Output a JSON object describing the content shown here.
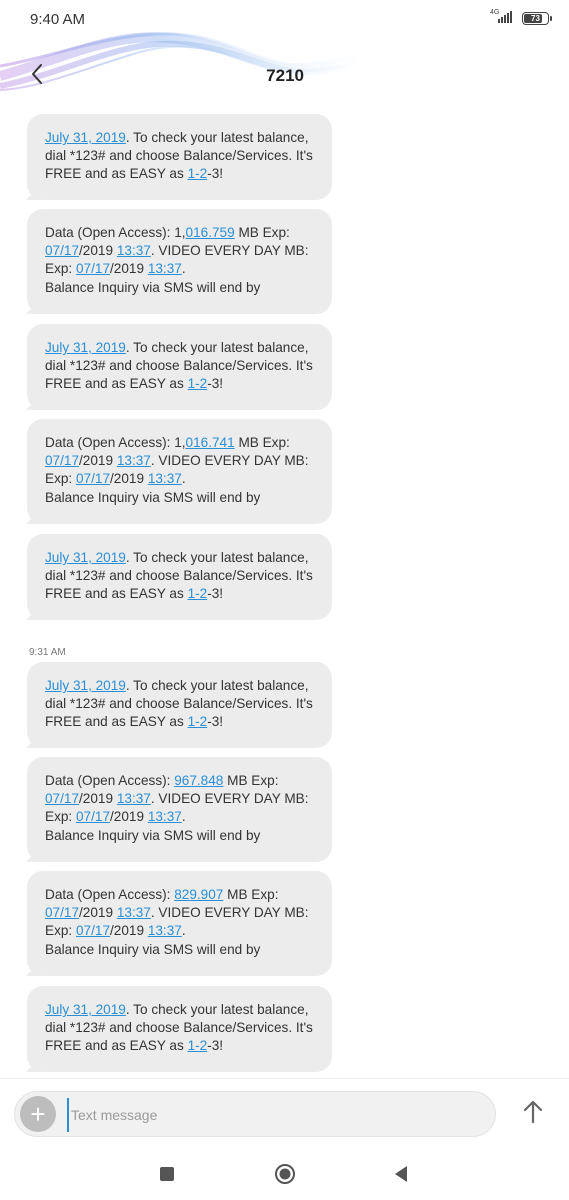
{
  "status_bar": {
    "time": "9:40 AM",
    "network_label": "4G",
    "battery_level": "73",
    "icons": [
      "signal-icon",
      "battery-icon"
    ]
  },
  "header": {
    "title": "7210",
    "back_icon": "chevron-left-icon"
  },
  "messages": [
    {
      "lines": [
        [
          {
            "t": " "
          },
          {
            "t": "July 31, 2019",
            "link": true
          },
          {
            "t": ".  To check your latest balance,"
          }
        ],
        [
          {
            "t": "dial *123# and choose Balance/Services. It's"
          }
        ],
        [
          {
            "t": "FREE and as EASY as "
          },
          {
            "t": "1-2",
            "link": true
          },
          {
            "t": "-3!"
          }
        ]
      ]
    },
    {
      "lines": [
        [
          {
            "t": "Data (Open Access): 1,"
          },
          {
            "t": "016.759",
            "link": true
          },
          {
            "t": " MB Exp:"
          }
        ],
        [
          {
            "t": "07/17",
            "link": true
          },
          {
            "t": "/2019 "
          },
          {
            "t": "13:37",
            "link": true
          },
          {
            "t": ".  VIDEO EVERY DAY MB:"
          }
        ],
        [
          {
            "t": "Exp: "
          },
          {
            "t": "07/17",
            "link": true
          },
          {
            "t": "/2019 "
          },
          {
            "t": "13:37",
            "link": true
          },
          {
            "t": "."
          }
        ],
        [
          {
            "t": " Balance Inquiry via SMS will end by"
          }
        ]
      ]
    },
    {
      "lines": [
        [
          {
            "t": " "
          },
          {
            "t": "July 31, 2019",
            "link": true
          },
          {
            "t": ".  To check your latest balance,"
          }
        ],
        [
          {
            "t": "dial *123# and choose Balance/Services. It's"
          }
        ],
        [
          {
            "t": "FREE and as EASY as "
          },
          {
            "t": "1-2",
            "link": true
          },
          {
            "t": "-3!"
          }
        ]
      ]
    },
    {
      "lines": [
        [
          {
            "t": "Data (Open Access): 1,"
          },
          {
            "t": "016.741",
            "link": true
          },
          {
            "t": " MB Exp:"
          }
        ],
        [
          {
            "t": "07/17",
            "link": true
          },
          {
            "t": "/2019 "
          },
          {
            "t": "13:37",
            "link": true
          },
          {
            "t": ".  VIDEO EVERY DAY MB:"
          }
        ],
        [
          {
            "t": "Exp: "
          },
          {
            "t": "07/17",
            "link": true
          },
          {
            "t": "/2019 "
          },
          {
            "t": "13:37",
            "link": true
          },
          {
            "t": "."
          }
        ],
        [
          {
            "t": " Balance Inquiry via SMS will end by"
          }
        ]
      ]
    },
    {
      "lines": [
        [
          {
            "t": " "
          },
          {
            "t": "July 31, 2019",
            "link": true
          },
          {
            "t": ".  To check your latest balance,"
          }
        ],
        [
          {
            "t": "dial *123# and choose Balance/Services. It's"
          }
        ],
        [
          {
            "t": "FREE and as EASY as "
          },
          {
            "t": "1-2",
            "link": true
          },
          {
            "t": "-3!"
          }
        ]
      ]
    },
    {
      "lines": [
        [
          {
            "t": " "
          },
          {
            "t": "July 31, 2019",
            "link": true
          },
          {
            "t": ".  To check your latest balance,"
          }
        ],
        [
          {
            "t": "dial *123# and choose Balance/Services. It's"
          }
        ],
        [
          {
            "t": "FREE and as EASY as "
          },
          {
            "t": "1-2",
            "link": true
          },
          {
            "t": "-3!"
          }
        ]
      ]
    },
    {
      "lines": [
        [
          {
            "t": "Data (Open Access): "
          },
          {
            "t": "967.848",
            "link": true
          },
          {
            "t": " MB Exp:"
          }
        ],
        [
          {
            "t": "07/17",
            "link": true
          },
          {
            "t": "/2019 "
          },
          {
            "t": "13:37",
            "link": true
          },
          {
            "t": ".  VIDEO EVERY DAY MB:"
          }
        ],
        [
          {
            "t": "Exp: "
          },
          {
            "t": "07/17",
            "link": true
          },
          {
            "t": "/2019 "
          },
          {
            "t": "13:37",
            "link": true
          },
          {
            "t": "."
          }
        ],
        [
          {
            "t": " Balance Inquiry via SMS will end by"
          }
        ]
      ]
    },
    {
      "lines": [
        [
          {
            "t": "Data (Open Access): "
          },
          {
            "t": "829.907",
            "link": true
          },
          {
            "t": " MB Exp:"
          }
        ],
        [
          {
            "t": "07/17",
            "link": true
          },
          {
            "t": "/2019 "
          },
          {
            "t": "13:37",
            "link": true
          },
          {
            "t": ".  VIDEO EVERY DAY MB:"
          }
        ],
        [
          {
            "t": "Exp: "
          },
          {
            "t": "07/17",
            "link": true
          },
          {
            "t": "/2019 "
          },
          {
            "t": "13:37",
            "link": true
          },
          {
            "t": "."
          }
        ],
        [
          {
            "t": " Balance Inquiry via SMS will end by"
          }
        ]
      ]
    },
    {
      "lines": [
        [
          {
            "t": " "
          },
          {
            "t": "July 31, 2019",
            "link": true
          },
          {
            "t": ".  To check your latest balance,"
          }
        ],
        [
          {
            "t": "dial *123# and choose Balance/Services. It's"
          }
        ],
        [
          {
            "t": "FREE and as EASY as "
          },
          {
            "t": "1-2",
            "link": true
          },
          {
            "t": "-3!"
          }
        ]
      ]
    }
  ],
  "time_separator": "9:31 AM",
  "composer": {
    "placeholder": "Text message",
    "attach_icon": "plus-icon",
    "send_icon": "arrow-up-icon"
  },
  "nav_bar": {
    "icons": [
      "square-recents-icon",
      "circle-home-icon",
      "triangle-back-icon"
    ]
  },
  "colors": {
    "bubble": "#ececec",
    "link": "#2a8fd6",
    "text": "#333333"
  }
}
